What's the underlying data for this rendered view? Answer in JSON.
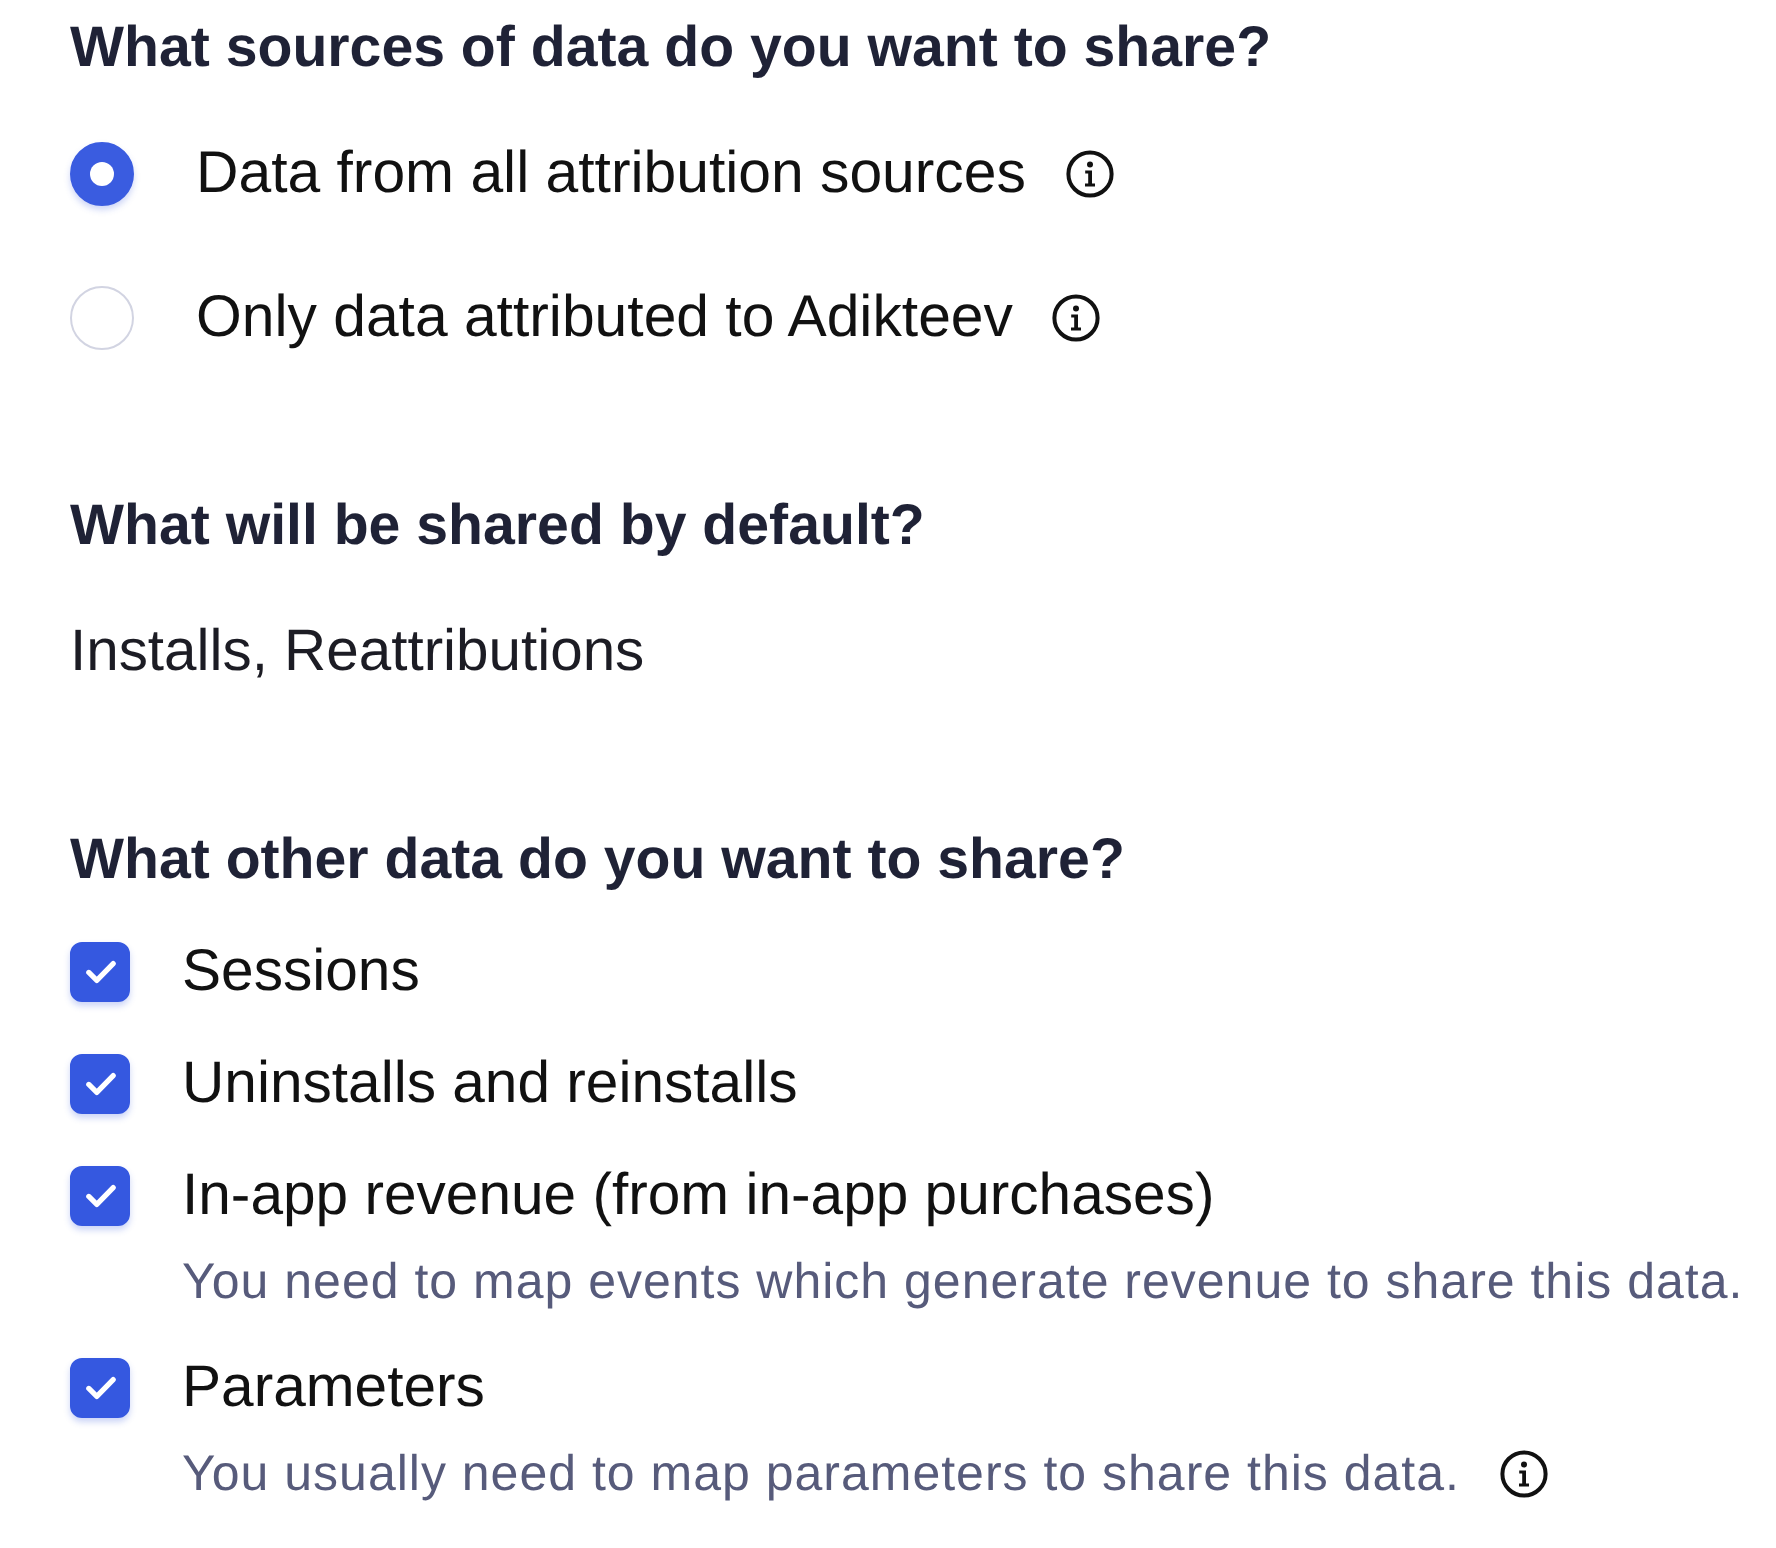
{
  "sections": [
    {
      "kind": "radio_group",
      "heading": "What sources of data do you want to share?",
      "options": [
        {
          "label": "Data from all attribution sources",
          "selected": true,
          "info": true
        },
        {
          "label": "Only data attributed to Adikteev",
          "selected": false,
          "info": true
        }
      ]
    },
    {
      "kind": "text",
      "heading": "What will be shared by default?",
      "text": "Installs, Reattributions"
    },
    {
      "kind": "checkbox_group",
      "heading": "What other data do you want to share?",
      "options": [
        {
          "label": "Sessions",
          "checked": true
        },
        {
          "label": "Uninstalls and reinstalls",
          "checked": true
        },
        {
          "label": "In-app revenue (from in-app purchases)",
          "checked": true,
          "hint": "You need to map events which generate revenue to share this data.",
          "hint_info": false
        },
        {
          "label": "Parameters",
          "checked": true,
          "hint": "You usually need to map parameters to share this data.",
          "hint_info": true
        }
      ]
    }
  ]
}
